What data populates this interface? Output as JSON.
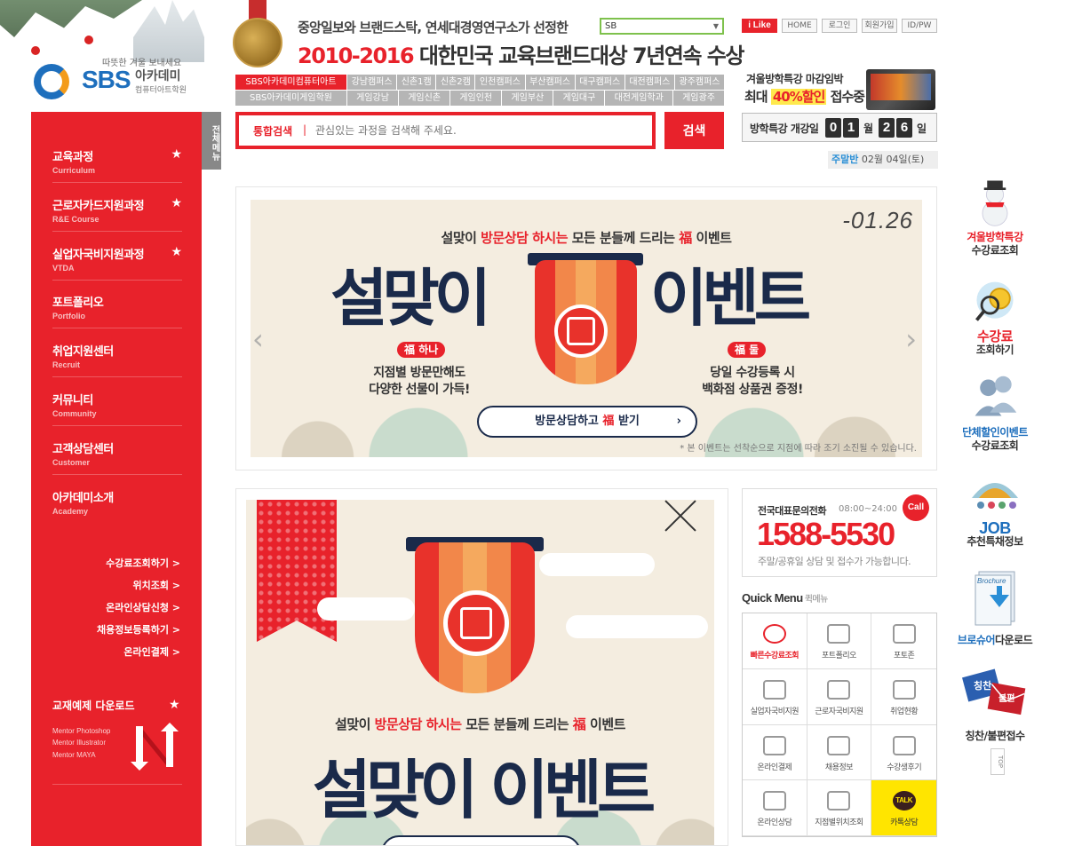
{
  "logo": {
    "greeting": "따뜻한 겨울 보내세요",
    "brand": "SBS",
    "name": "아카데미",
    "sub": "컴퓨터아트학원"
  },
  "award": {
    "line1": "중앙일보와 브랜드스탁, 연세대경영연구소가 선정한",
    "years": "2010-2016",
    "line2_mid": " 대한민국 교육브랜드대상 ",
    "line2_end": "7년연속 수상"
  },
  "site_select": {
    "value": "SB"
  },
  "campus_row1": [
    "SBS아카데미컴퓨터아트",
    "강남캠퍼스",
    "신촌1캠",
    "신촌2캠",
    "인천캠퍼스",
    "부산캠퍼스",
    "대구캠퍼스",
    "대전캠퍼스",
    "광주캠퍼스"
  ],
  "campus_row2": [
    "SBS아카데미게임학원",
    "게임강남",
    "게임신촌",
    "게임인천",
    "게임부산",
    "게임대구",
    "대전게임학과",
    "게임광주"
  ],
  "search": {
    "label": "통합검색",
    "separator": "|",
    "placeholder": "관심있는 과정을 검색해 주세요.",
    "button": "검색"
  },
  "top_links": {
    "ilike": "i Like",
    "home": "HOME",
    "login": "로그인",
    "join": "회원가입",
    "idpw": "ID/PW"
  },
  "promo": {
    "line1": "겨울방학특강 마감임박",
    "line2_a": "최대 ",
    "line2_hl": "40%할인",
    "line2_b": " 접수중"
  },
  "countdown": {
    "label": "방학특강 개강일",
    "month_digits": [
      "0",
      "1"
    ],
    "month_unit": "월",
    "day_digits": [
      "2",
      "6"
    ],
    "day_unit": "일"
  },
  "date_line": {
    "label": "주말반",
    "date": "02월 04일(토)"
  },
  "all_menu": "전체메뉴",
  "sidebar": {
    "items": [
      {
        "title": "교육과정",
        "en": "Curriculum",
        "star": "★"
      },
      {
        "title": "근로자카드지원과정",
        "en": "R&E Course",
        "star": "★"
      },
      {
        "title": "실업자국비지원과정",
        "en": "VTDA",
        "star": "★"
      },
      {
        "title": "포트폴리오",
        "en": "Portfolio",
        "star": ""
      },
      {
        "title": "취업지원센터",
        "en": "Recruit",
        "star": ""
      },
      {
        "title": "커뮤니티",
        "en": "Community",
        "star": ""
      },
      {
        "title": "고객상담센터",
        "en": "Customer",
        "star": ""
      },
      {
        "title": "아카데미소개",
        "en": "Academy",
        "star": ""
      }
    ],
    "links": [
      "수강료조회하기 >",
      "위치조회 >",
      "온라인상담신청 >",
      "채용정보등록하기 >",
      "온라인결제 >"
    ],
    "download_title": "교재예제 다운로드",
    "download_star": "★",
    "mentors": [
      "Mentor Photoshop",
      "Mentor Illustrator",
      "Mentor MAYA"
    ]
  },
  "banner": {
    "date": "-01.26",
    "sub_a": "설맞이 ",
    "sub_r": "방문상담 하시는",
    "sub_b": " 모든 분들께 드리는 ",
    "sub_fu": "福",
    "sub_c": " 이벤트",
    "title_left": "설맞이",
    "title_right": "이벤트",
    "tag1": "福 하나",
    "text1": "지점별 방문만해도\n다양한 선물이 가득!",
    "tag2": "福 둘",
    "text2": "당일 수강등록 시\n백화점 상품권 증정!",
    "button_a": "방문상담하고 ",
    "button_r": "福",
    "button_b": " 받기",
    "button_arrow": "›",
    "note": "* 본 이벤트는 선착순으로 지점에 따라 조기 소진될 수 있습니다.",
    "arrow_left": "‹",
    "arrow_right": "›"
  },
  "popup": {
    "sub_a": "설맞이 ",
    "sub_r": "방문상담 하시는",
    "sub_b": " 모든 분들께 드리는 ",
    "sub_fu": "福",
    "sub_c": " 이벤트",
    "title": "설맞이 이벤트"
  },
  "contact": {
    "label": "전국대표문의전화",
    "hours": "08:00~24:00",
    "call": "Call",
    "phone": "1588-5530",
    "note": "주말/공휴일 상담 및 접수가 가능합니다."
  },
  "quick_menu": {
    "title": "Quick Menu",
    "title_ko": "퀵메뉴",
    "items": [
      "빠른수강료조회",
      "포트폴리오",
      "포토존",
      "실업자국비지원",
      "근로자국비지원",
      "취업현황",
      "온라인결제",
      "채용정보",
      "수강생후기",
      "온라인상담",
      "지점별위치조회",
      "카톡상담"
    ],
    "talk_badge": "TALK"
  },
  "quick_bar": [
    {
      "t1": "겨울방학특강",
      "t2": "수강료조회"
    },
    {
      "t1": "수강료",
      "t2": "조회하기"
    },
    {
      "t1": "단체할인이벤트",
      "t2": "수강료조회"
    },
    {
      "t1": "JOB",
      "t2": "추천특채정보"
    },
    {
      "t1": "브로슈어",
      "t2": "다운로드"
    },
    {
      "t1": "",
      "t2": "칭찬/불편접수"
    }
  ],
  "quick_bar_labels": {
    "brochure": "Brochure",
    "praise": "칭찬",
    "complain": "불편"
  },
  "top_button": "TOP"
}
